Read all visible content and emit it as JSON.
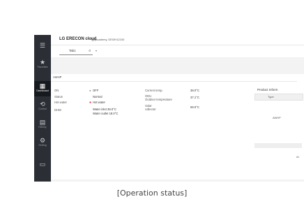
{
  "sidebar": {
    "items": [
      {
        "icon": "menu-icon",
        "glyph": "☰",
        "label": ""
      },
      {
        "icon": "star-icon",
        "glyph": "★",
        "label": "Favorites"
      },
      {
        "icon": "dashboard-icon",
        "glyph": "▦",
        "label": "Dashboard"
      },
      {
        "icon": "control-icon",
        "glyph": "⟲",
        "label": "Control"
      },
      {
        "icon": "history-icon",
        "glyph": "▤",
        "label": "History"
      },
      {
        "icon": "setting-icon",
        "glyph": "⚙",
        "label": "Setting"
      },
      {
        "icon": "more-icon",
        "glyph": "▭",
        "label": ""
      }
    ],
    "active_index": 2
  },
  "header": {
    "brand": "LG ERECON cloud",
    "account": "lgbjacademy, DEI3H12240"
  },
  "tabs": {
    "name": "Tab1",
    "count": "0",
    "dropdown": "▾"
  },
  "card": {
    "title": "AWHP",
    "rows": [
      {
        "label": "ON",
        "value": "OFF",
        "indicator": "●"
      },
      {
        "label": "Status",
        "value": "Normal",
        "indicator": ""
      },
      {
        "label": "Hot water",
        "value": "Hot water",
        "indicator": "●"
      },
      {
        "label": "DHW",
        "value_line1": "Water inlet 38.0°C",
        "value_line2": "Water outlet 18.0°C"
      }
    ],
    "right_rows": [
      {
        "label": "Current temp.",
        "value": "38.0°C"
      },
      {
        "label_line1": "ODU",
        "label_line2": "Outdoor temperature",
        "value": "37.1°C"
      },
      {
        "label_line1": "Solar",
        "label_line2": "collector",
        "value": "59.0°C"
      }
    ]
  },
  "product_info": {
    "title": "Product Inform",
    "type_label": "Type",
    "type_value": "AWHP",
    "last_value": "AI"
  },
  "caption": "[Operation status]"
}
